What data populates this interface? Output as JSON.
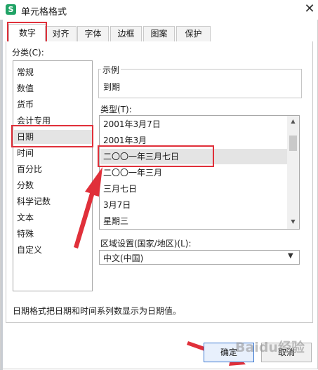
{
  "window": {
    "title": "单元格格式",
    "app_icon": "S",
    "close_glyph": "✕"
  },
  "tabs": [
    {
      "label": "数字",
      "active": true
    },
    {
      "label": "对齐"
    },
    {
      "label": "字体"
    },
    {
      "label": "边框"
    },
    {
      "label": "图案"
    },
    {
      "label": "保护"
    }
  ],
  "category": {
    "label": "分类(C):",
    "items": [
      "常规",
      "数值",
      "货币",
      "会计专用",
      "日期",
      "时间",
      "百分比",
      "分数",
      "科学记数",
      "文本",
      "特殊",
      "自定义"
    ],
    "selected": "日期"
  },
  "sample": {
    "label": "示例",
    "value": "到期"
  },
  "type": {
    "label": "类型(T):",
    "items": [
      "2001年3月7日",
      "2001年3月",
      "二〇〇一年三月七日",
      "二〇〇一年三月",
      "三月七日",
      "3月7日",
      "星期三"
    ],
    "selected": "二〇〇一年三月七日"
  },
  "locale": {
    "label": "区域设置(国家/地区)(L):",
    "value": "中文(中国)"
  },
  "description": "日期格式把日期和时间系列数显示为日期值。",
  "buttons": {
    "ok": "确定",
    "cancel": "取消"
  },
  "watermark": "Baidu经验",
  "colors": {
    "highlight": "#e0303a",
    "app_icon": "#21a366"
  }
}
